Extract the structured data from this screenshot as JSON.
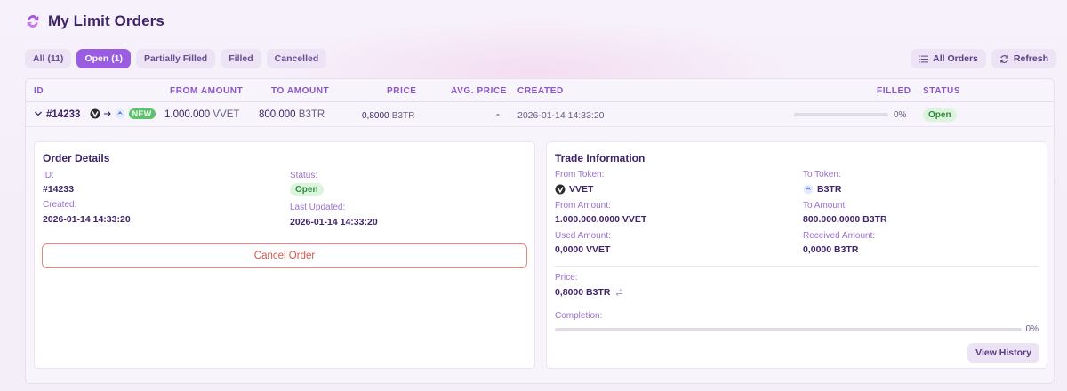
{
  "page": {
    "title": "My Limit Orders"
  },
  "filters": [
    {
      "label": "All (11)",
      "active": false
    },
    {
      "label": "Open (1)",
      "active": true
    },
    {
      "label": "Partially Filled",
      "active": false
    },
    {
      "label": "Filled",
      "active": false
    },
    {
      "label": "Cancelled",
      "active": false
    }
  ],
  "actions": {
    "all_orders": "All Orders",
    "refresh": "Refresh"
  },
  "table": {
    "headers": {
      "id": "ID",
      "from_amount": "FROM AMOUNT",
      "to_amount": "TO AMOUNT",
      "price": "PRICE",
      "avg_price": "AVG. PRICE",
      "created": "CREATED",
      "filled": "FILLED",
      "status": "STATUS"
    },
    "row": {
      "id": "#14233",
      "badge": "NEW",
      "from_amount": "1.000.000",
      "from_token": "VVET",
      "to_amount": "800.000",
      "to_token": "B3TR",
      "price": "0,8000",
      "price_token": "B3TR",
      "avg_price": "-",
      "created": "2026-01-14 14:33:20",
      "filled_pct": "0%",
      "filled_fraction": 0,
      "status": "Open"
    }
  },
  "order_details": {
    "title": "Order Details",
    "id_label": "ID:",
    "id_value": "#14233",
    "status_label": "Status:",
    "status_value": "Open",
    "created_label": "Created:",
    "created_value": "2026-01-14 14:33:20",
    "updated_label": "Last Updated:",
    "updated_value": "2026-01-14 14:33:20",
    "cancel_button": "Cancel Order"
  },
  "trade_info": {
    "title": "Trade Information",
    "from_token_label": "From Token:",
    "from_token_value": "VVET",
    "to_token_label": "To Token:",
    "to_token_value": "B3TR",
    "from_amount_label": "From Amount:",
    "from_amount_value": "1.000.000,0000 VVET",
    "to_amount_label": "To Amount:",
    "to_amount_value": "800.000,0000 B3TR",
    "used_amount_label": "Used Amount:",
    "used_amount_value": "0,0000 VVET",
    "received_amount_label": "Received Amount:",
    "received_amount_value": "0,0000 B3TR",
    "price_label": "Price:",
    "price_value": "0,8000 B3TR",
    "completion_label": "Completion:",
    "completion_pct": "0%",
    "completion_fraction": 0,
    "view_history": "View History"
  },
  "colors": {
    "accent": "#9a5ce0",
    "open_green": "#2f8a3c",
    "new_badge": "#5bc46a",
    "danger": "#d4584d"
  },
  "icons": [
    "swap-logo-icon",
    "list-icon",
    "refresh-icon",
    "chevron-down-icon",
    "vvet-token-icon",
    "arrow-right-icon",
    "b3tr-token-icon",
    "swap-arrows-icon"
  ]
}
